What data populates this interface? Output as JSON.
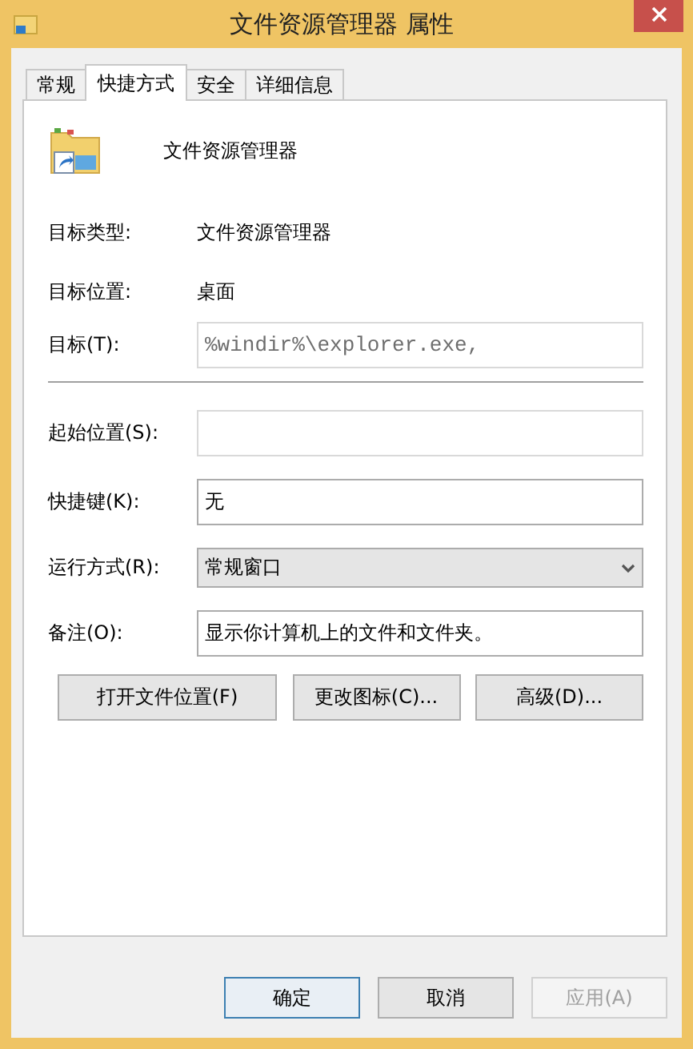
{
  "window": {
    "title": "文件资源管理器 属性"
  },
  "tabs": [
    {
      "label": "常规",
      "selected": false
    },
    {
      "label": "快捷方式",
      "selected": true
    },
    {
      "label": "安全",
      "selected": false
    },
    {
      "label": "详细信息",
      "selected": false
    }
  ],
  "shortcut": {
    "name": "文件资源管理器"
  },
  "info": [
    {
      "label": "目标类型:",
      "value": "文件资源管理器"
    },
    {
      "label": "目标位置:",
      "value": "桌面"
    }
  ],
  "target": {
    "label": "目标(T):",
    "value": "%windir%\\explorer.exe,",
    "disabled": true
  },
  "fields": [
    {
      "kind": "text",
      "label": "起始位置(S):",
      "disabled": true
    },
    {
      "kind": "text",
      "label": "快捷键(K):",
      "value": "无",
      "disabled": false
    },
    {
      "kind": "select",
      "label": "运行方式(R):",
      "value": "常规窗口",
      "disabled": false
    },
    {
      "kind": "text",
      "label": "备注(O):",
      "value": "显示你计算机上的文件和文件夹。",
      "disabled": false
    }
  ],
  "actions": [
    "打开文件位置(F)",
    "更改图标(C)...",
    "高级(D)..."
  ],
  "buttons": [
    {
      "label": "确定",
      "default": true,
      "disabled": false
    },
    {
      "label": "取消",
      "default": false,
      "disabled": false
    },
    {
      "label": "应用(A)",
      "default": false,
      "disabled": true
    }
  ]
}
